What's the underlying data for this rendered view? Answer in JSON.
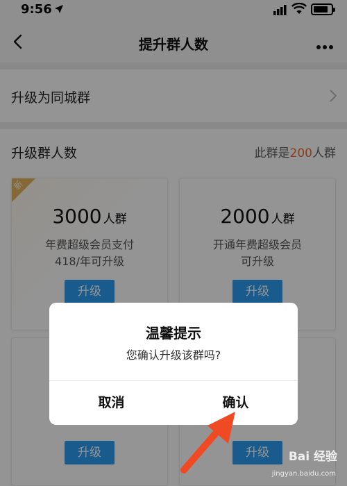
{
  "status_bar": {
    "time": "9:56"
  },
  "nav": {
    "title": "提升群人数"
  },
  "upgrade_row": {
    "label": "升级为同城群"
  },
  "section": {
    "title": "升级群人数",
    "info_prefix": "此群是",
    "info_value": "200",
    "info_suffix": "人群"
  },
  "cards": [
    {
      "badge": "新",
      "count": "3000",
      "unit": "人群",
      "desc_line1": "年费超级会员支付",
      "desc_line2": "418/年可升级",
      "button": "升级"
    },
    {
      "count": "2000",
      "unit": "人群",
      "desc_line1": "开通年费超级会员",
      "desc_line2": "可升级",
      "button": "升级"
    },
    {
      "button": "升级"
    },
    {
      "button": "升级"
    }
  ],
  "dialog": {
    "title": "温馨提示",
    "message": "您确认升级该群吗?",
    "cancel": "取消",
    "confirm": "确认"
  },
  "watermark": {
    "text": "Bai 经验",
    "sub": "jingyan.baidu.com"
  },
  "colors": {
    "accent_blue": "#2a9ef2",
    "highlight_orange": "#f06a30",
    "badge_gold": "#e5b35a",
    "arrow_red": "#f04a25"
  }
}
